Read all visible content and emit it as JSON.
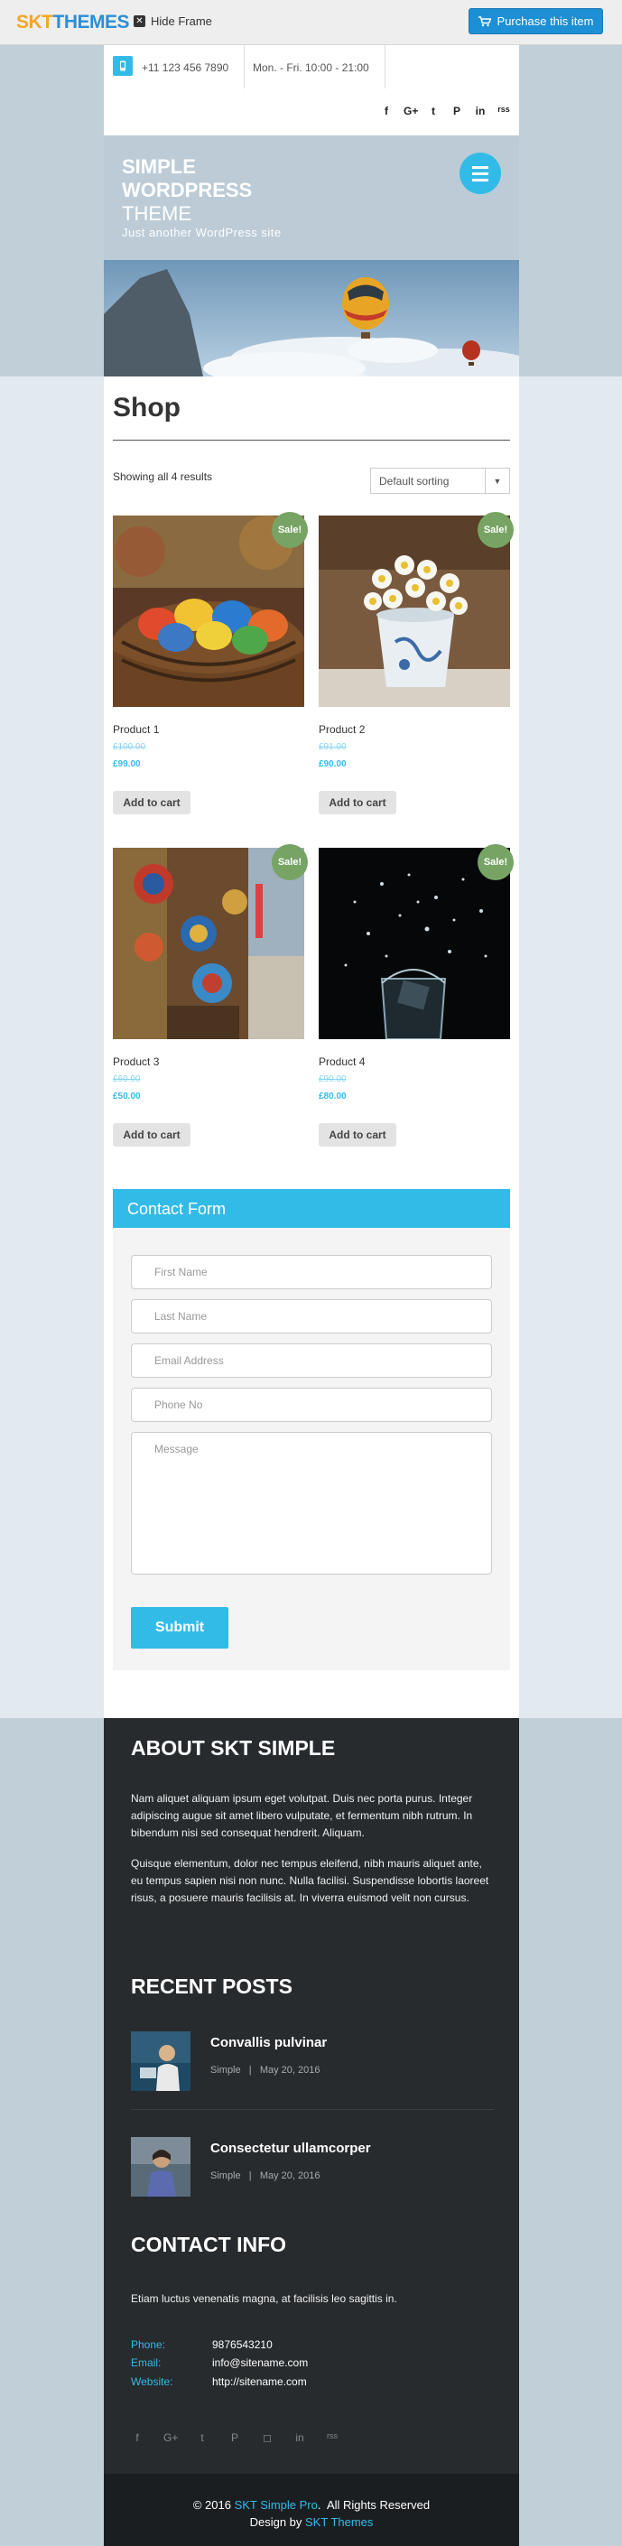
{
  "topbar": {
    "logo_a": "SKT",
    "logo_b": "THEMES",
    "hide_frame": "Hide Frame",
    "purchase": "Purchase this item"
  },
  "header": {
    "phone": "+11 123 456 7890",
    "hours": "Mon. - Fri. 10:00 - 21:00",
    "social_icons": [
      "facebook-icon",
      "google-plus-icon",
      "twitter-icon",
      "pinterest-icon",
      "linkedin-icon",
      "rss-icon"
    ],
    "social_glyphs": [
      "f",
      "G+",
      "t",
      "P",
      "in",
      "rss"
    ]
  },
  "hero": {
    "title_line1": "SIMPLE",
    "title_line2": "WORDPRESS",
    "title_line3": "THEME",
    "tagline": "Just another WordPress site"
  },
  "shop": {
    "title": "Shop",
    "results": "Showing all 4 results",
    "sort": "Default sorting",
    "sale_label": "Sale!",
    "cart_label": "Add to cart",
    "products": [
      {
        "name": "Product 1",
        "old_price": "£100.00",
        "price": "£99.00"
      },
      {
        "name": "Product 2",
        "old_price": "£91.00",
        "price": "£90.00"
      },
      {
        "name": "Product 3",
        "old_price": "£60.00",
        "price": "£50.00"
      },
      {
        "name": "Product 4",
        "old_price": "£90.00",
        "price": "£80.00"
      }
    ]
  },
  "contact_form": {
    "heading": "Contact Form",
    "first_name": "First Name",
    "last_name": "Last Name",
    "email": "Email Address",
    "phone": "Phone No",
    "message": "Message",
    "submit": "Submit"
  },
  "footer": {
    "about_heading": "ABOUT SKT SIMPLE",
    "about_p1": "Nam aliquet aliquam ipsum eget volutpat. Duis nec porta purus. Integer adipiscing augue sit amet libero vulputate, et fermentum nibh rutrum. In bibendum nisi sed consequat hendrerit. Aliquam.",
    "about_p2": "Quisque elementum, dolor nec tempus eleifend, nibh mauris aliquet ante, eu tempus sapien nisi non nunc. Nulla facilisi. Suspendisse lobortis laoreet risus, a posuere mauris facilisis at. In viverra euismod velit non cursus.",
    "recent_heading": "RECENT POSTS",
    "posts": [
      {
        "title": "Convallis pulvinar",
        "meta": "Simple   |   May 20, 2016"
      },
      {
        "title": "Consectetur ullamcorper",
        "meta": "Simple   |   May 20, 2016"
      }
    ],
    "contact_heading": "CONTACT INFO",
    "contact_text": "Etiam luctus venenatis magna, at facilisis leo sagittis in.",
    "phone_label": "Phone:",
    "phone_value": "9876543210",
    "email_label": "Email:",
    "email_value": "info@sitename.com",
    "website_label": "Website:",
    "website_value": "http://sitename.com"
  },
  "copyright": {
    "prefix": "© 2016 ",
    "brand": "SKT Simple Pro",
    "suffix": ".  All Rights Reserved",
    "design_by": "Design by ",
    "designer": "SKT Themes"
  },
  "colors": {
    "accent": "#33bbe8",
    "sale": "#77a464",
    "footer_bg": "#272b2e",
    "purchase": "#1d8fd4"
  }
}
